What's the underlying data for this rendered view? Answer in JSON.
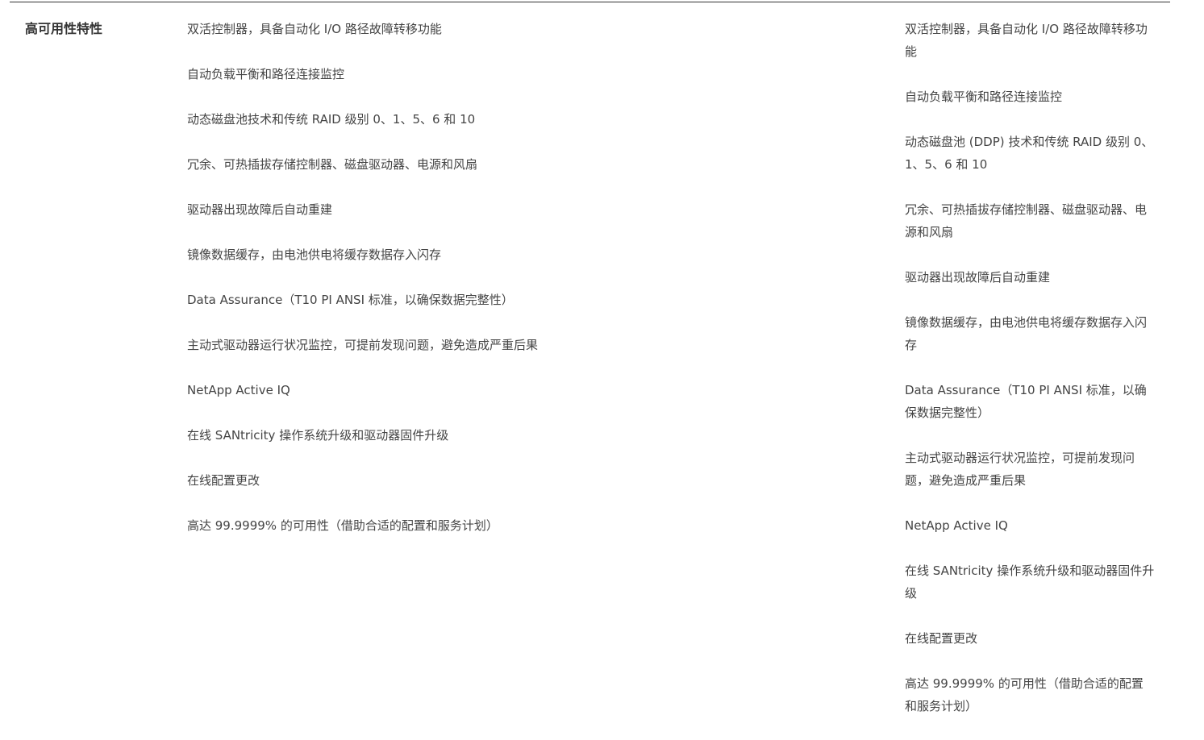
{
  "row": {
    "label": "高可用性特性"
  },
  "column_a": {
    "items": [
      "双活控制器，具备自动化 I/O 路径故障转移功能",
      "自动负载平衡和路径连接监控",
      "动态磁盘池技术和传统 RAID 级别 0、1、5、6 和 10",
      "冗余、可热插拔存储控制器、磁盘驱动器、电源和风扇",
      "驱动器出现故障后自动重建",
      "镜像数据缓存，由电池供电将缓存数据存入闪存",
      "Data Assurance（T10 PI ANSI 标准，以确保数据完整性）",
      "主动式驱动器运行状况监控，可提前发现问题，避免造成严重后果",
      "NetApp Active IQ",
      "在线 SANtricity 操作系统升级和驱动器固件升级",
      "在线配置更改",
      "高达 99.9999% 的可用性（借助合适的配置和服务计划）"
    ]
  },
  "column_b": {
    "items": [
      "双活控制器，具备自动化 I/O 路径故障转移功能",
      "自动负载平衡和路径连接监控",
      "动态磁盘池 (DDP) 技术和传统 RAID 级别 0、1、5、6 和 10",
      "冗余、可热插拔存储控制器、磁盘驱动器、电源和风扇",
      "驱动器出现故障后自动重建",
      "镜像数据缓存，由电池供电将缓存数据存入闪存",
      "Data Assurance（T10 PI ANSI 标准，以确保数据完整性）",
      "主动式驱动器运行状况监控，可提前发现问题，避免造成严重后果",
      "NetApp Active IQ",
      "在线 SANtricity 操作系统升级和驱动器固件升级",
      "在线配置更改",
      "高达 99.9999% 的可用性（借助合适的配置和服务计划）"
    ]
  }
}
